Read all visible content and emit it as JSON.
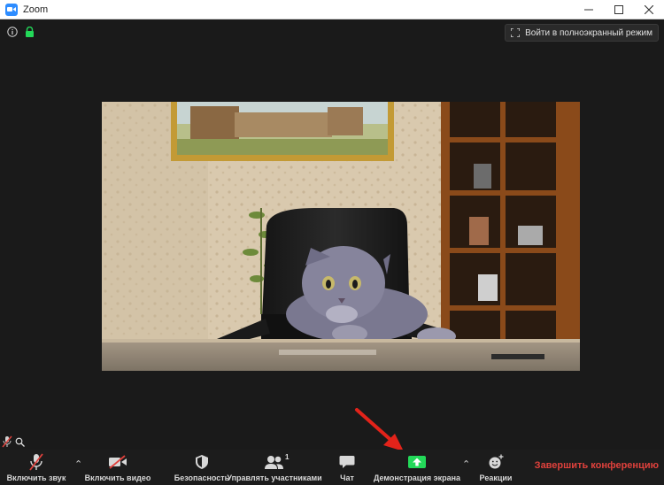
{
  "window": {
    "title": "Zoom"
  },
  "header": {
    "fullscreen_label": "Войти в полноэкранный режим"
  },
  "toolbar": {
    "unmute_label": "Включить звук",
    "video_label": "Включить видео",
    "security_label": "Безопасность",
    "participants_label": "Управлять участниками",
    "participants_count": "1",
    "chat_label": "Чат",
    "share_label": "Демонстрация экрана",
    "reactions_label": "Реакции",
    "end_label": "Завершить конференцию"
  },
  "colors": {
    "accent_blue": "#2d8cff",
    "share_green": "#23d959",
    "end_red": "#e0413c",
    "lock_green": "#23d959",
    "arrow_red": "#e2231a"
  }
}
